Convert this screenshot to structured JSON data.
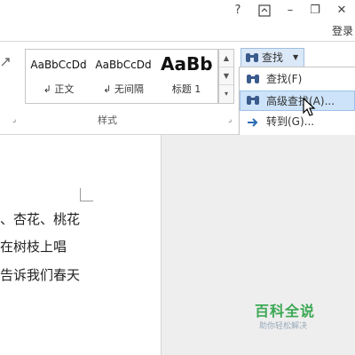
{
  "titlebar": {
    "help": "?",
    "ribbon_display": "⊼",
    "minimize": "–",
    "restore": "❐",
    "close": "✕",
    "login": "登录"
  },
  "ribbon": {
    "styles_group_label": "样式",
    "styles": [
      {
        "sample": "AaBbCcDd",
        "label": "↲ 正文"
      },
      {
        "sample": "AaBbCcDd",
        "label": "↲ 无间隔"
      },
      {
        "sample": "AaBb",
        "label": "标题 1"
      }
    ],
    "find_button_label": "查找"
  },
  "find_menu": {
    "items": [
      {
        "label": "查找(F)",
        "icon": "binoculars-icon"
      },
      {
        "label": "高级查找(A)...",
        "icon": "binoculars-icon"
      },
      {
        "label": "转到(G)...",
        "icon": "arrow-right-icon"
      }
    ]
  },
  "document": {
    "lines": [
      "、杏花、桃花",
      "在树枝上唱",
      "告诉我们春天"
    ]
  },
  "watermark": {
    "title": "百科全说",
    "subtitle": "助你轻松解决"
  }
}
